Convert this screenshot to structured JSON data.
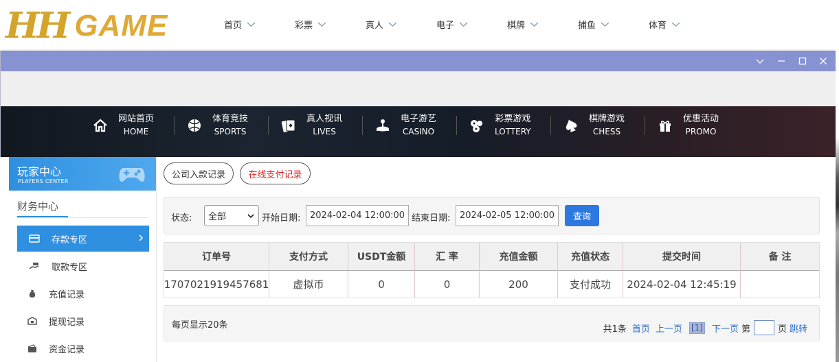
{
  "site": {
    "logo": {
      "mark": "HH",
      "word": "GAME"
    },
    "nav": [
      {
        "label": "首页"
      },
      {
        "label": "彩票"
      },
      {
        "label": "真人"
      },
      {
        "label": "电子"
      },
      {
        "label": "棋牌"
      },
      {
        "label": "捕鱼"
      },
      {
        "label": "体育"
      }
    ]
  },
  "window": {
    "titlebar_color": "#8792d2",
    "buttons": [
      "collapse",
      "minimize",
      "maximize",
      "close"
    ]
  },
  "banner_nav": [
    {
      "cn": "网站首页",
      "en": "HOME",
      "icon": "home-icon"
    },
    {
      "cn": "体育竞技",
      "en": "SPORTS",
      "icon": "ball-icon"
    },
    {
      "cn": "真人视讯",
      "en": "LIVES",
      "icon": "cards-icon"
    },
    {
      "cn": "电子游艺",
      "en": "CASINO",
      "icon": "joystick-icon"
    },
    {
      "cn": "彩票游戏",
      "en": "LOTTERY",
      "icon": "lottery-balls-icon"
    },
    {
      "cn": "棋牌游戏",
      "en": "CHESS",
      "icon": "spade-icon"
    },
    {
      "cn": "优惠活动",
      "en": "PROMO",
      "icon": "gift-icon"
    }
  ],
  "sidebar": {
    "header_title": "玩家中心",
    "header_sub": "PLAYERS CENTER",
    "section": "财务中心",
    "items": [
      {
        "label": "存款专区",
        "icon": "card-icon",
        "active": true
      },
      {
        "label": "取款专区",
        "icon": "hand-money-icon",
        "active": false
      },
      {
        "label": "充值记录",
        "icon": "money-bag-icon",
        "active": false
      },
      {
        "label": "提现记录",
        "icon": "withdraw-icon",
        "active": false
      },
      {
        "label": "资金记录",
        "icon": "wallet-icon",
        "active": false
      }
    ]
  },
  "tabs": [
    {
      "label": "公司入款记录",
      "active": false
    },
    {
      "label": "在线支付记录",
      "active": true
    }
  ],
  "filter": {
    "status_label": "状态:",
    "status_value": "全部",
    "start_label": "开始日期:",
    "start_value": "2024-02-04 12:00:00",
    "end_label": "结束日期:",
    "end_value": "2024-02-05 12:00:00",
    "query_label": "查询"
  },
  "table": {
    "headers": [
      "订单号",
      "支付方式",
      "USDT金额",
      "汇 率",
      "充值金额",
      "充值状态",
      "提交时间",
      "备 注"
    ],
    "rows": [
      [
        "1707021919457681",
        "虚拟币",
        "0",
        "0",
        "200",
        "支付成功",
        "2024-02-04 12:45:19",
        ""
      ]
    ]
  },
  "pager": {
    "page_size_text": "每页显示20条",
    "total_text": "共1条",
    "first": "首页",
    "prev": "上一页",
    "current": "[1]",
    "next": "下一页",
    "goto_prefix": "第",
    "goto_suffix": "页",
    "jump": "跳转"
  },
  "colors": {
    "accent": "#2f8fe0",
    "query_button": "#2d78e0",
    "active_tab_text": "#e02020",
    "logo_gold": "#d3a52c"
  }
}
